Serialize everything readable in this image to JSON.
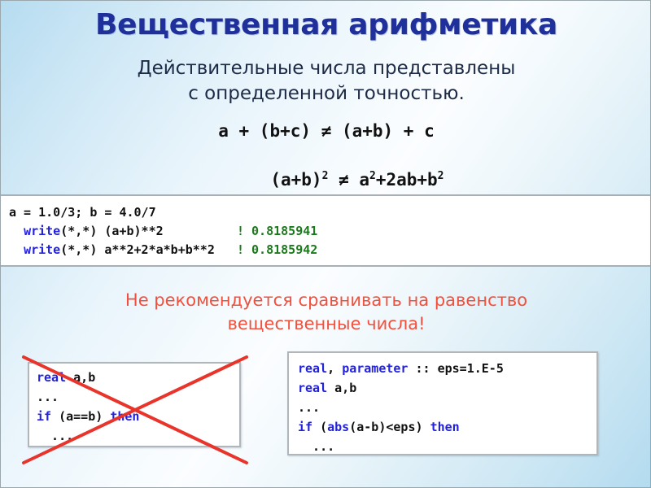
{
  "slide": {
    "title": "Вещественная арифметика",
    "subtitle_lines": [
      "Действительные числа представлены",
      "с определенной точностью."
    ],
    "formulas": [
      "a + (b+c) ≠ (a+b) + c"
    ],
    "formula2": {
      "lhs_base": "(a+b)",
      "lhs_exp": "2",
      "rel": " ≠ ",
      "rhs_a": "a",
      "rhs_a_exp": "2",
      "rhs_mid": "+2ab+b",
      "rhs_b_exp": "2"
    },
    "warning_lines": [
      "Не рекомендуется сравнивать на равенство",
      "вещественные числа!"
    ]
  },
  "main_code": {
    "line1": "a = 1.0/3; b = 4.0/7",
    "line2": {
      "indent": "  ",
      "kw": "write",
      "rest": "(*,*) (a+b)**2",
      "pad": "          ",
      "comment": "! 0.8185941"
    },
    "line3": {
      "indent": "  ",
      "kw": "write",
      "rest": "(*,*) a**2+2*a*b+b**2",
      "pad": "   ",
      "comment": "! 0.8185942"
    }
  },
  "bad_code": {
    "line1": {
      "kw": "real",
      "rest": " a,b"
    },
    "line2": "...",
    "line3": {
      "kw1": "if",
      "mid": " (a==b) ",
      "kw2": "then"
    },
    "line4": "  ..."
  },
  "good_code": {
    "line1": {
      "kw1": "real",
      "sep": ", ",
      "kw2": "parameter",
      "rest": " :: eps=1.E-5"
    },
    "line2": {
      "kw": "real",
      "rest": " a,b"
    },
    "line3": "...",
    "line4": {
      "kw1": "if",
      "mid1": " (",
      "kw2": "abs",
      "mid2": "(a-b)<eps) ",
      "kw3": "then"
    },
    "line5": "  ..."
  },
  "colors": {
    "title": "#20309a",
    "subtitle": "#1d2b46",
    "warning": "#f2503c",
    "keyword": "#2222dd",
    "comment": "#1b7a1b",
    "cross": "#e8342a",
    "code_text": "#111111"
  }
}
